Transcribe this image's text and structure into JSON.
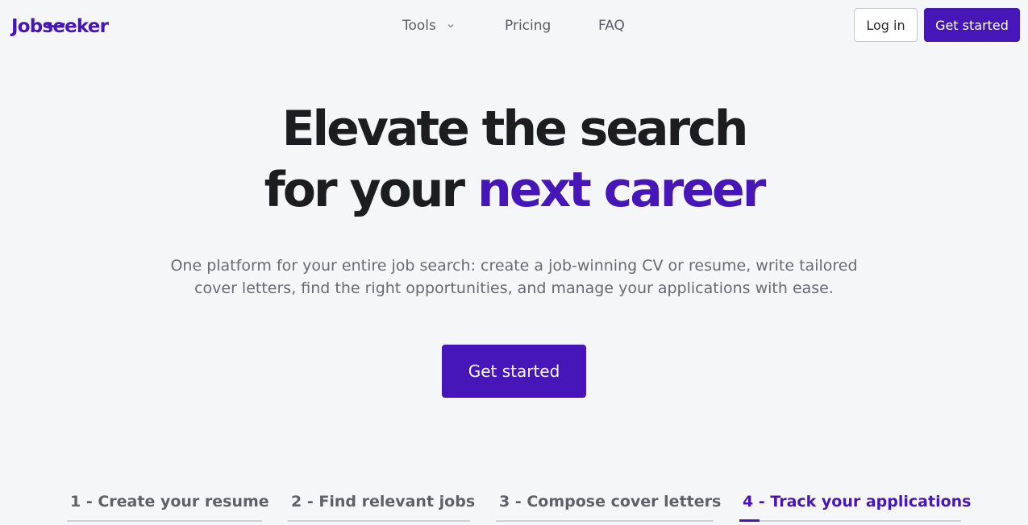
{
  "brand": {
    "name": "Jobseeker",
    "color": "#4616b8"
  },
  "nav": {
    "items": [
      {
        "label": "Tools",
        "has_dropdown": true
      },
      {
        "label": "Pricing"
      },
      {
        "label": "FAQ"
      }
    ]
  },
  "header": {
    "login_label": "Log in",
    "get_started_label": "Get started"
  },
  "hero": {
    "title_line1": "Elevate the search",
    "title_line2_prefix": "for your ",
    "title_line2_accent": "next career",
    "subtitle": "One platform for your entire job search: create a job-winning CV or resume, write tailored cover letters, find the right opportunities, and manage your applications with ease.",
    "cta_label": "Get started"
  },
  "steps": {
    "items": [
      {
        "label": "1 - Create your resume",
        "active": false
      },
      {
        "label": "2 - Find relevant jobs",
        "active": false
      },
      {
        "label": "3 - Compose cover letters",
        "active": false
      },
      {
        "label": "4 - Track your applications",
        "active": true,
        "progress": 0.09
      }
    ]
  },
  "colors": {
    "accent": "#4616b8",
    "background": "#f5f6f8",
    "text_muted": "#686a74"
  },
  "icons": {
    "tools_dropdown": "chevron-down-icon"
  }
}
